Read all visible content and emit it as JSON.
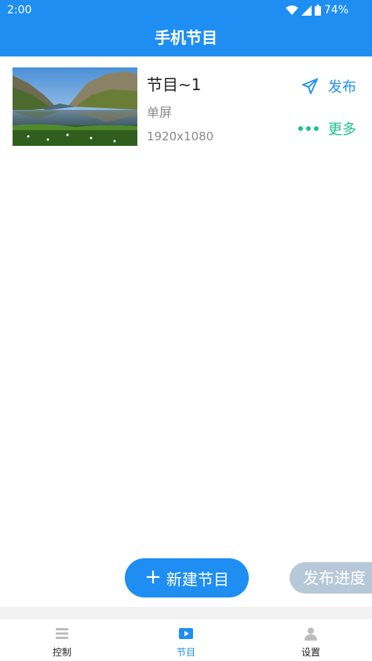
{
  "status_bar": {
    "time": "2:00",
    "battery": "74%"
  },
  "app_bar": {
    "title": "手机节目"
  },
  "program": {
    "name": "节目~1",
    "mode": "单屏",
    "resolution": "1920x1080",
    "publish_label": "发布",
    "more_label": "更多"
  },
  "actions": {
    "new_program": "新建节目",
    "publish_progress": "发布进度"
  },
  "bottom_nav": {
    "items": [
      {
        "label": "控制",
        "icon": "list-icon"
      },
      {
        "label": "节目",
        "icon": "play-icon",
        "active": true
      },
      {
        "label": "设置",
        "icon": "user-icon"
      }
    ]
  },
  "colors": {
    "primary": "#1e8ef3",
    "more": "#19c28e",
    "progress_bg": "#b7c9d8"
  }
}
